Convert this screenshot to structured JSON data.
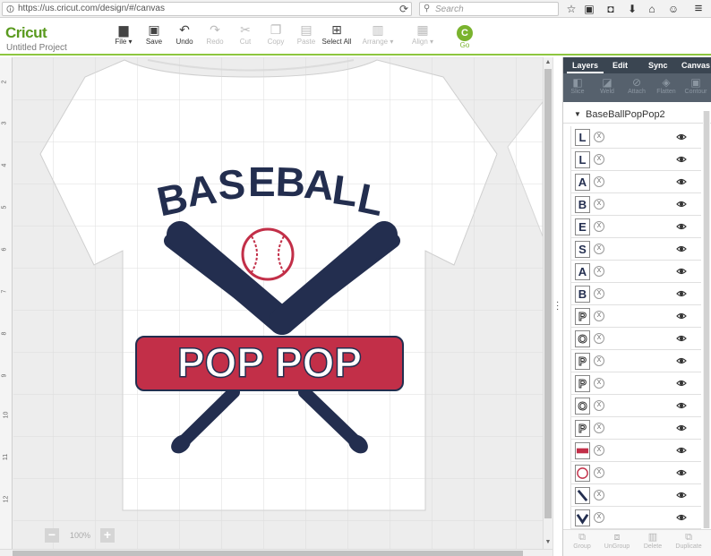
{
  "browser": {
    "url": "https://us.cricut.com/design/#/canvas",
    "search_placeholder": "Search"
  },
  "app": {
    "logo": "Cricut",
    "project_name": "Untitled Project",
    "toolbar": {
      "file": "File ▾",
      "save": "Save",
      "undo": "Undo",
      "redo": "Redo",
      "cut": "Cut",
      "copy": "Copy",
      "paste": "Paste",
      "select_all": "Select All",
      "arrange": "Arrange ▾",
      "align": "Align ▾",
      "go": "Go"
    }
  },
  "canvas": {
    "ruler_numbers": [
      "2",
      "3",
      "4",
      "5",
      "6",
      "7",
      "8",
      "9",
      "10",
      "11",
      "12"
    ],
    "zoom": "100%",
    "design": {
      "top_text": "BASEBALL",
      "banner_text": "POP POP",
      "colors": {
        "navy": "#232e4f",
        "red": "#c22f48",
        "white": "#ffffff"
      }
    }
  },
  "panel": {
    "tabs": [
      "Layers",
      "Edit",
      "Sync",
      "Canvas"
    ],
    "actions": [
      "Slice",
      "Weld",
      "Attach",
      "Flatten",
      "Contour"
    ],
    "group_name": "BaseBallPopPop2",
    "layers": [
      {
        "glyph": "L",
        "kind": "letter-navy"
      },
      {
        "glyph": "L",
        "kind": "letter-navy"
      },
      {
        "glyph": "A",
        "kind": "letter-navy"
      },
      {
        "glyph": "B",
        "kind": "letter-navy"
      },
      {
        "glyph": "E",
        "kind": "letter-navy"
      },
      {
        "glyph": "S",
        "kind": "letter-navy"
      },
      {
        "glyph": "A",
        "kind": "letter-navy"
      },
      {
        "glyph": "B",
        "kind": "letter-navy"
      },
      {
        "glyph": "P",
        "kind": "letter-outline"
      },
      {
        "glyph": "O",
        "kind": "letter-outline"
      },
      {
        "glyph": "P",
        "kind": "letter-outline"
      },
      {
        "glyph": "P",
        "kind": "letter-outline"
      },
      {
        "glyph": "O",
        "kind": "letter-outline"
      },
      {
        "glyph": "P",
        "kind": "letter-outline"
      },
      {
        "glyph": "",
        "kind": "banner"
      },
      {
        "glyph": "",
        "kind": "ball"
      },
      {
        "glyph": "",
        "kind": "bat"
      },
      {
        "glyph": "",
        "kind": "bats-v"
      }
    ],
    "bottom_actions": [
      "Group",
      "UnGroup",
      "Delete",
      "Duplicate"
    ]
  }
}
